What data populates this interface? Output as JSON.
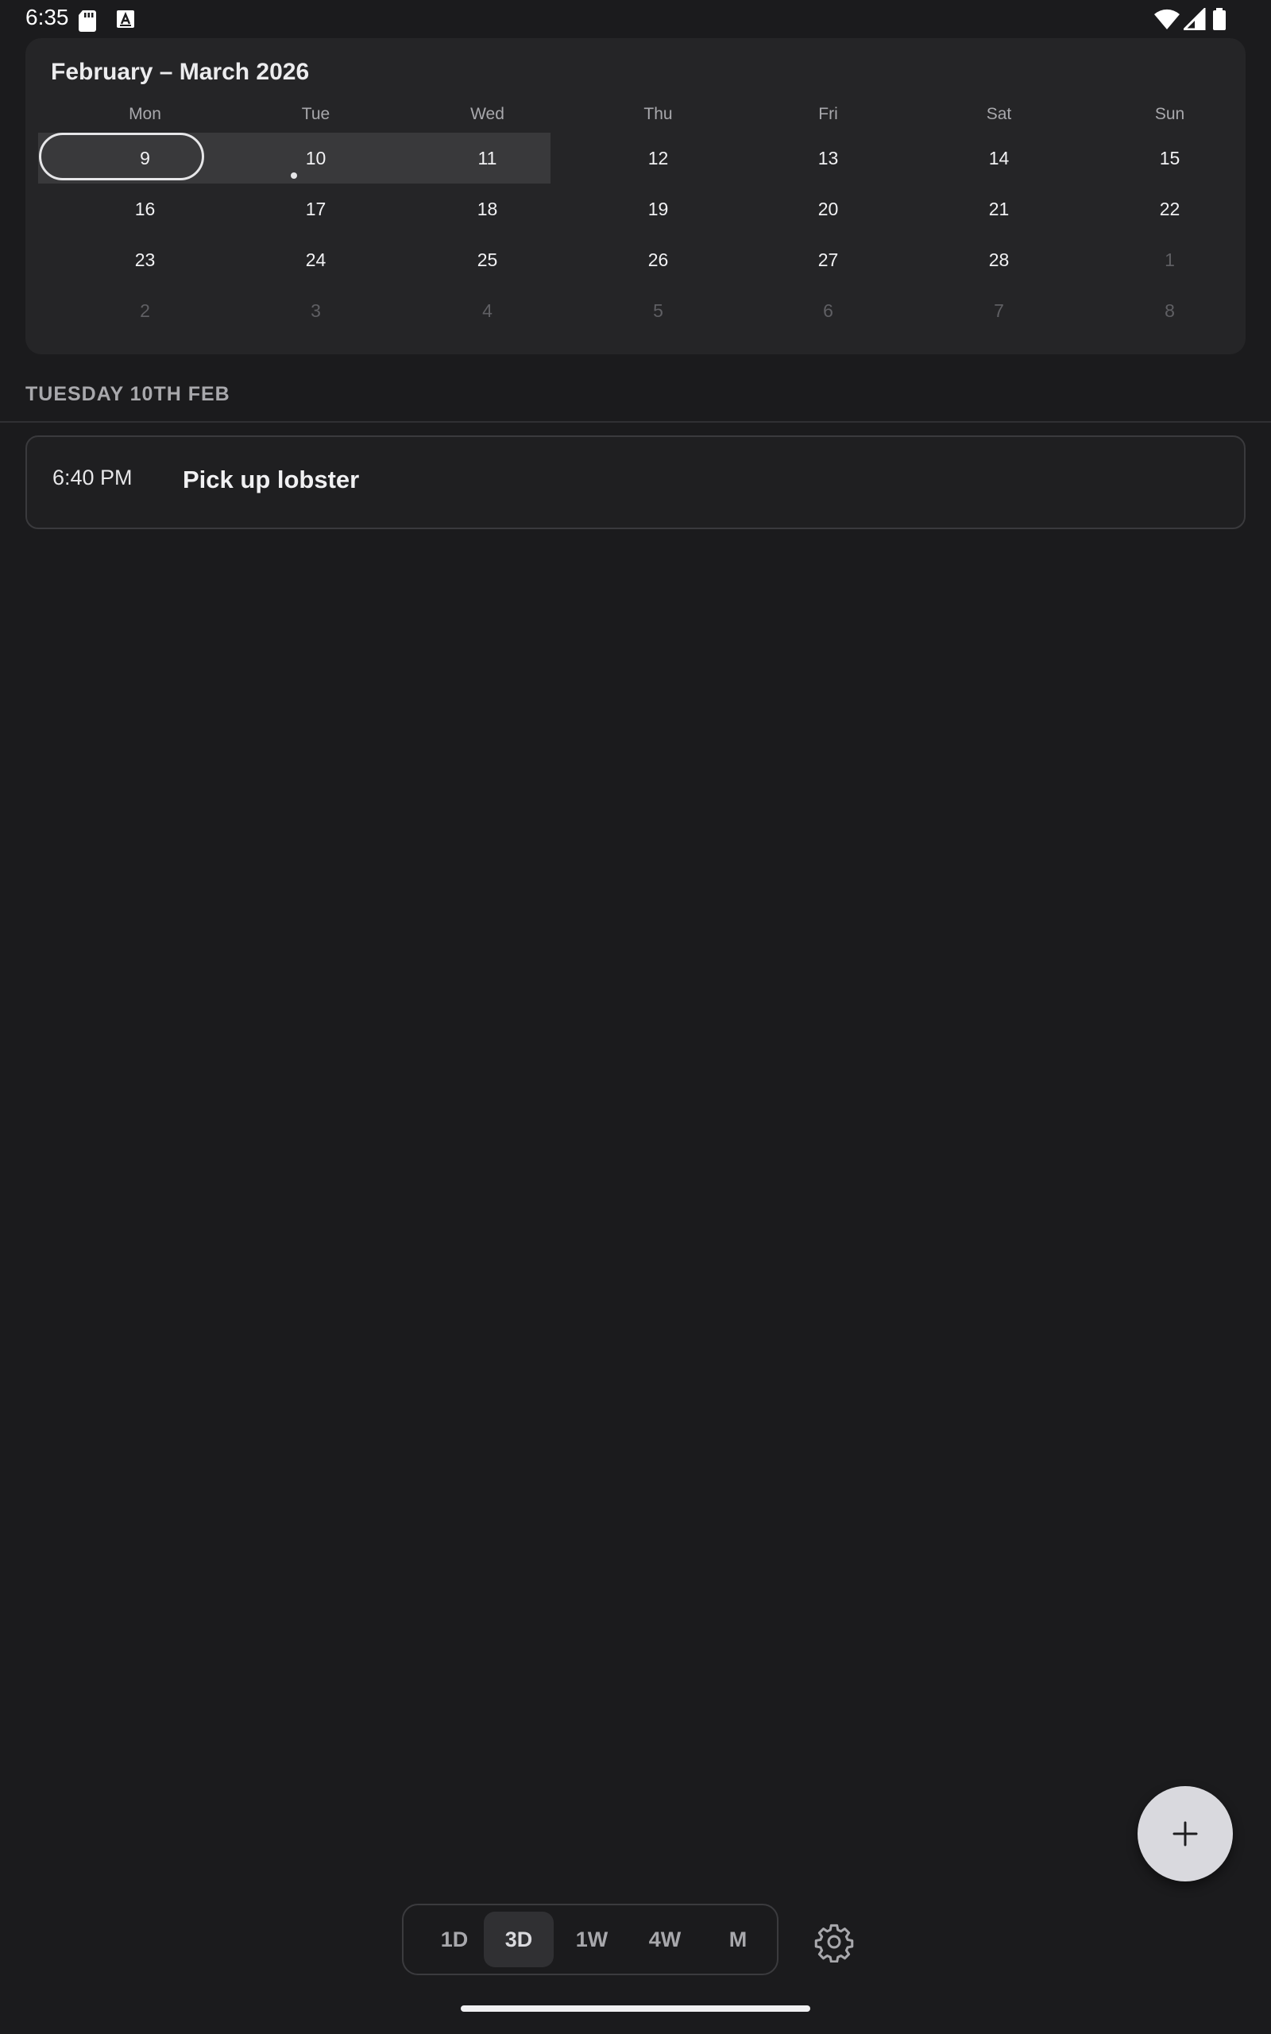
{
  "status_bar": {
    "time": "6:35",
    "left_icons": [
      "sd-card-icon",
      "keyboard-a-icon"
    ],
    "right_icons": [
      "wifi-icon",
      "cell-signal-icon",
      "battery-icon"
    ]
  },
  "calendar": {
    "title": "February – March 2026",
    "weekdays": [
      "Mon",
      "Tue",
      "Wed",
      "Thu",
      "Fri",
      "Sat",
      "Sun"
    ],
    "weeks": [
      [
        "9",
        "10",
        "11",
        "12",
        "13",
        "14",
        "15"
      ],
      [
        "16",
        "17",
        "18",
        "19",
        "20",
        "21",
        "22"
      ],
      [
        "23",
        "24",
        "25",
        "26",
        "27",
        "28",
        "1"
      ],
      [
        "2",
        "3",
        "4",
        "5",
        "6",
        "7",
        "8"
      ]
    ],
    "today": "9",
    "selected_range": [
      "9",
      "10",
      "11"
    ],
    "days_with_events": [
      "10"
    ]
  },
  "agenda": {
    "section_header": "TUESDAY 10TH FEB",
    "events": [
      {
        "time": "6:40 PM",
        "title": "Pick up lobster"
      }
    ]
  },
  "fab": {
    "icon": "plus-icon"
  },
  "view_switcher": {
    "options": [
      "1D",
      "3D",
      "1W",
      "4W",
      "M"
    ],
    "selected": "3D",
    "settings_icon": "gear-icon"
  },
  "colors": {
    "background": "#1b1b1d",
    "card": "#252527",
    "range_highlight": "#39393b",
    "fab": "#d9d9de",
    "muted_text": "#a8a8ac"
  }
}
